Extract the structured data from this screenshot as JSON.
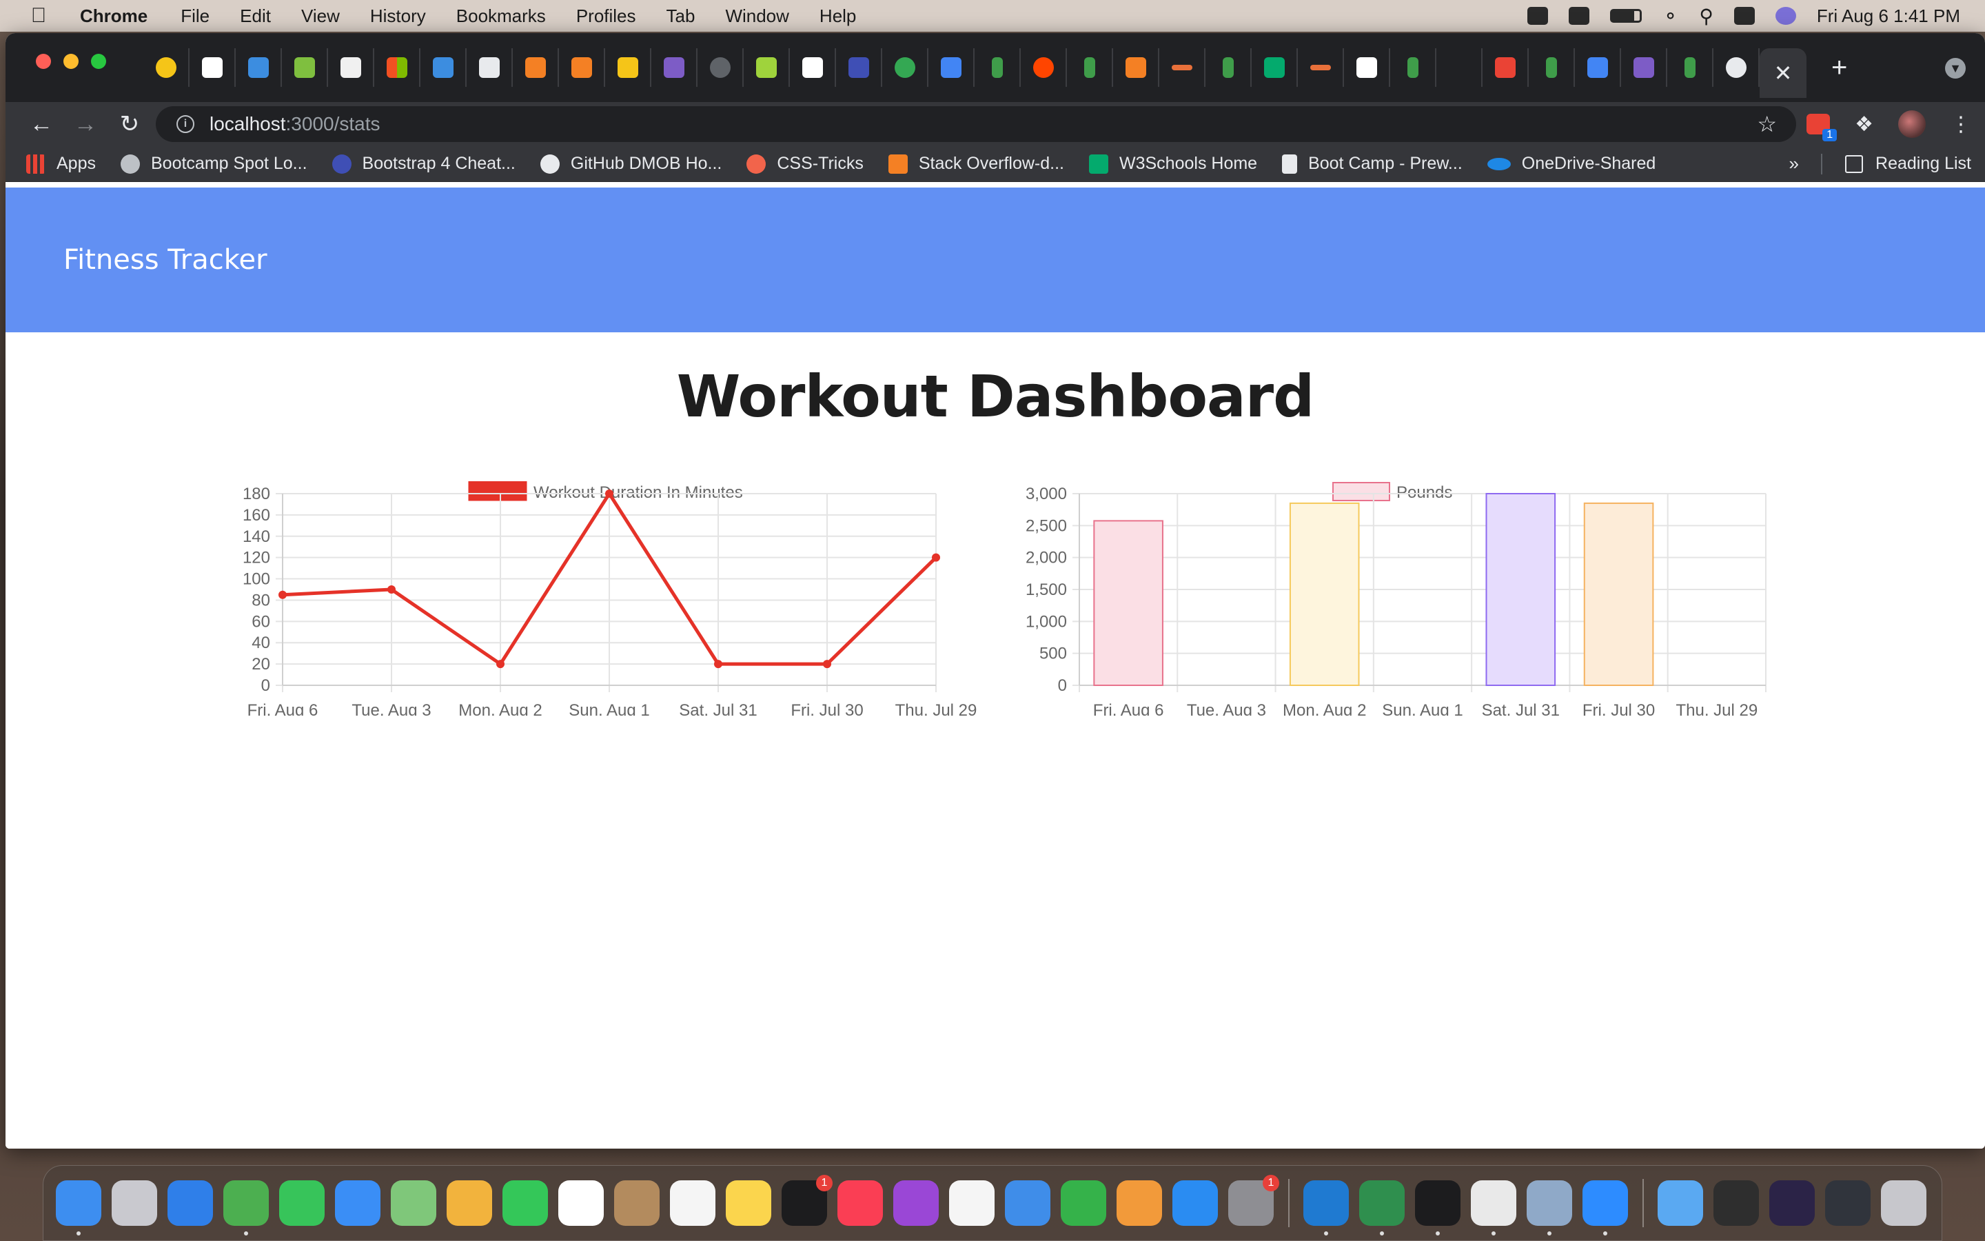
{
  "menubar": {
    "app_name": "Chrome",
    "items": [
      "File",
      "Edit",
      "View",
      "History",
      "Bookmarks",
      "Profiles",
      "Tab",
      "Window",
      "Help"
    ],
    "datetime": "Fri Aug 6  1:41 PM"
  },
  "browser": {
    "url_host": "localhost",
    "url_path": ":3000/stats",
    "extension_badge": "1",
    "bookmarks": [
      {
        "label": "Apps",
        "color": "#e8eaed",
        "icon": "apps-grid-icon"
      },
      {
        "label": "Bootcamp Spot Lo...",
        "color": "#bdc1c6",
        "icon": "globe-icon"
      },
      {
        "label": "Bootstrap 4 Cheat...",
        "color": "#3f4fb5",
        "icon": "hashnode-icon"
      },
      {
        "label": "GitHub DMOB Ho...",
        "color": "#e8eaed",
        "icon": "github-icon"
      },
      {
        "label": "CSS-Tricks",
        "color": "#f2644b",
        "icon": "css-tricks-icon"
      },
      {
        "label": "Stack Overflow-d...",
        "color": "#f48024",
        "icon": "stackoverflow-icon"
      },
      {
        "label": "W3Schools Home",
        "color": "#04aa6d",
        "icon": "w3schools-icon"
      },
      {
        "label": "Boot Camp - Prew...",
        "color": "#e8eaed",
        "icon": "book-icon"
      },
      {
        "label": "OneDrive-Shared",
        "color": "#1e88e5",
        "icon": "onedrive-icon"
      }
    ],
    "bookmarks_more": "»",
    "reading_list": "Reading List"
  },
  "page": {
    "brand": "Fitness Tracker",
    "title": "Workout Dashboard"
  },
  "chart_data": [
    {
      "type": "line",
      "legend": [
        "Workout Duration In Minutes"
      ],
      "categories": [
        "Fri, Aug 6",
        "Tue, Aug 3",
        "Mon, Aug 2",
        "Sun, Aug 1",
        "Sat, Jul 31",
        "Fri, Jul 30",
        "Thu, Jul 29"
      ],
      "series": [
        {
          "name": "Workout Duration In Minutes",
          "values": [
            85,
            90,
            20,
            180,
            20,
            20,
            120
          ],
          "color": "#e53228"
        }
      ],
      "ylim": [
        0,
        180
      ],
      "yticks": [
        "180",
        "160",
        "140",
        "120",
        "100",
        "80",
        "60",
        "40",
        "20",
        "0"
      ],
      "grid": true,
      "legend_position": "top"
    },
    {
      "type": "bar",
      "legend": [
        "Pounds"
      ],
      "categories": [
        "Fri, Aug 6",
        "Tue, Aug 3",
        "Mon, Aug 2",
        "Sun, Aug 1",
        "Sat, Jul 31",
        "Fri, Jul 30",
        "Thu, Jul 29"
      ],
      "series": [
        {
          "name": "Pounds",
          "values": [
            2575,
            0,
            2850,
            0,
            3000,
            2850,
            0
          ]
        }
      ],
      "bar_colors": [
        {
          "fill": "#fbdfe5",
          "stroke": "#e8728c"
        },
        {
          "fill": "#dde9fb",
          "stroke": "#6ea3e8"
        },
        {
          "fill": "#fef5dd",
          "stroke": "#f5c95c"
        },
        {
          "fill": "#def3ef",
          "stroke": "#6cc4b4"
        },
        {
          "fill": "#e6dcfd",
          "stroke": "#8e6af0"
        },
        {
          "fill": "#fdecd8",
          "stroke": "#f5b260"
        },
        {
          "fill": "#fbdfe5",
          "stroke": "#e8728c"
        }
      ],
      "ylim": [
        0,
        3000
      ],
      "yticks": [
        "3,000",
        "2,500",
        "2,000",
        "1,500",
        "1,000",
        "500",
        "0"
      ],
      "grid": true,
      "legend_position": "top"
    }
  ],
  "dock": {
    "apps": [
      {
        "name": "finder",
        "color": "#3d8ef0",
        "running": true
      },
      {
        "name": "launchpad",
        "color": "#c9c9cf",
        "running": false
      },
      {
        "name": "safari",
        "color": "#2f7fe9",
        "running": false
      },
      {
        "name": "chrome",
        "color": "#4caf50",
        "running": true
      },
      {
        "name": "messages",
        "color": "#37c45a",
        "running": false
      },
      {
        "name": "mail",
        "color": "#3a8ef6",
        "running": false
      },
      {
        "name": "maps",
        "color": "#7fc77a",
        "running": false
      },
      {
        "name": "photos",
        "color": "#f2b33d",
        "running": false
      },
      {
        "name": "facetime",
        "color": "#34c759",
        "running": false
      },
      {
        "name": "calendar",
        "color": "#ffffff",
        "running": false
      },
      {
        "name": "contacts",
        "color": "#b38b5e",
        "running": false
      },
      {
        "name": "reminders",
        "color": "#f5f5f5",
        "running": false
      },
      {
        "name": "notes",
        "color": "#fbd54d",
        "running": false
      },
      {
        "name": "apple-tv",
        "color": "#1c1c1e",
        "running": false,
        "badge": "1"
      },
      {
        "name": "music",
        "color": "#fa3e54",
        "running": false
      },
      {
        "name": "podcasts",
        "color": "#9a47d6",
        "running": false
      },
      {
        "name": "news",
        "color": "#f5f5f5",
        "running": false
      },
      {
        "name": "keynote",
        "color": "#3f8de9",
        "running": false
      },
      {
        "name": "numbers",
        "color": "#35b24a",
        "running": false
      },
      {
        "name": "pages",
        "color": "#f29a3a",
        "running": false
      },
      {
        "name": "app-store",
        "color": "#2a8cf2",
        "running": false
      },
      {
        "name": "system-preferences",
        "color": "#8e8e93",
        "running": false,
        "badge": "1"
      },
      {
        "name": "vscode",
        "color": "#1f7ad1",
        "running": true
      },
      {
        "name": "mongodb-compass",
        "color": "#2f8f4e",
        "running": true
      },
      {
        "name": "terminal",
        "color": "#1c1c1e",
        "running": true
      },
      {
        "name": "textedit",
        "color": "#e9e9e9",
        "running": true
      },
      {
        "name": "preview",
        "color": "#8fa9c8",
        "running": true
      },
      {
        "name": "zoom",
        "color": "#2d8cff",
        "running": true
      },
      {
        "name": "downloads-folder",
        "color": "#5aa9f2",
        "running": false
      },
      {
        "name": "screenshot-1",
        "color": "#2e2e2e",
        "running": false
      },
      {
        "name": "screenshot-2",
        "color": "#2b2347",
        "running": false
      },
      {
        "name": "screenshot-3",
        "color": "#30343c",
        "running": false
      },
      {
        "name": "trash",
        "color": "#c7c7cc",
        "running": false
      }
    ]
  }
}
